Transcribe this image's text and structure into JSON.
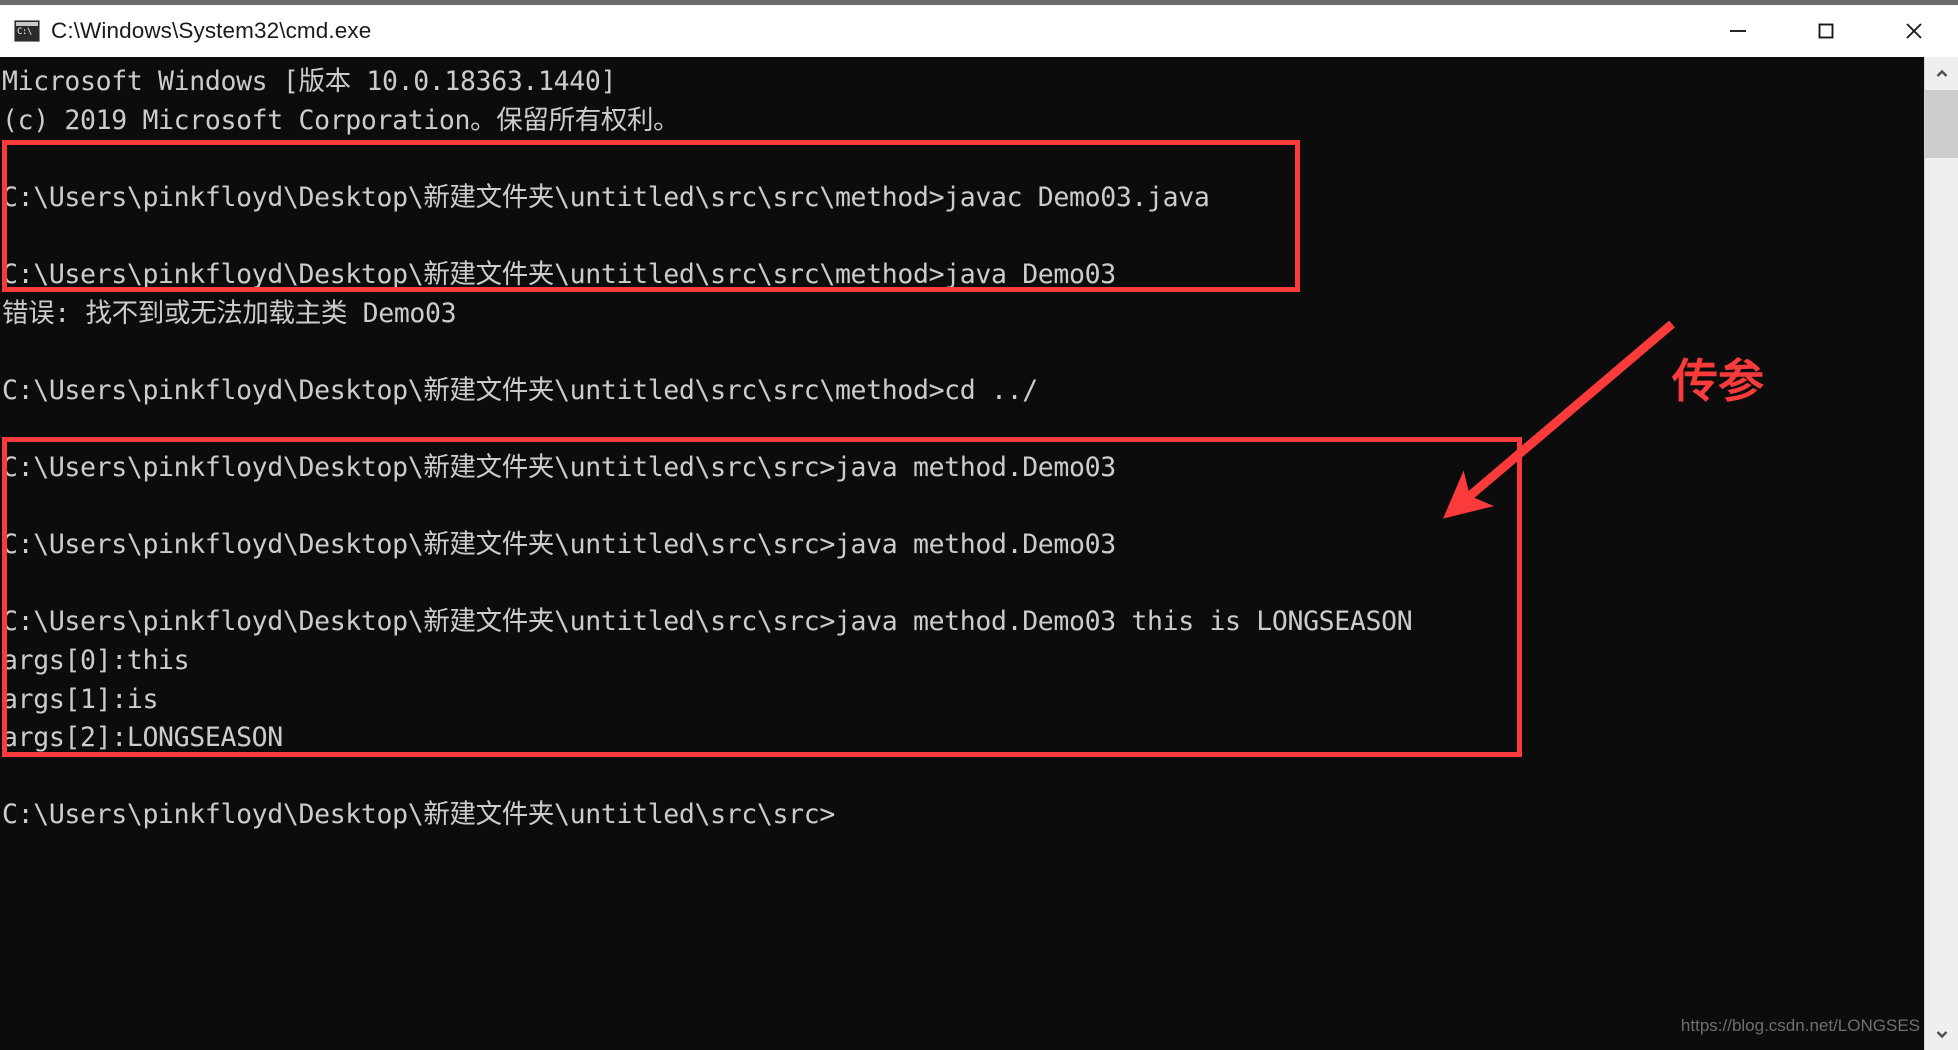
{
  "window": {
    "title": "C:\\Windows\\System32\\cmd.exe",
    "icon_label": "C:\\",
    "icon_name": "cmd-icon",
    "controls": {
      "minimize_label": "Minimize",
      "maximize_label": "Maximize",
      "close_label": "Close"
    }
  },
  "console": {
    "background_color": "#0c0c0c",
    "foreground_color": "#cccccc",
    "lines": [
      "Microsoft Windows [版本 10.0.18363.1440]",
      "(c) 2019 Microsoft Corporation。保留所有权利。",
      "",
      "C:\\Users\\pinkfloyd\\Desktop\\新建文件夹\\untitled\\src\\src\\method>javac Demo03.java",
      "",
      "C:\\Users\\pinkfloyd\\Desktop\\新建文件夹\\untitled\\src\\src\\method>java Demo03",
      "错误: 找不到或无法加载主类 Demo03",
      "",
      "C:\\Users\\pinkfloyd\\Desktop\\新建文件夹\\untitled\\src\\src\\method>cd ../",
      "",
      "C:\\Users\\pinkfloyd\\Desktop\\新建文件夹\\untitled\\src\\src>java method.Demo03",
      "",
      "C:\\Users\\pinkfloyd\\Desktop\\新建文件夹\\untitled\\src\\src>java method.Demo03",
      "",
      "C:\\Users\\pinkfloyd\\Desktop\\新建文件夹\\untitled\\src\\src>java method.Demo03 this is LONGSEASON",
      "args[0]:this",
      "args[1]:is",
      "args[2]:LONGSEASON",
      "",
      "C:\\Users\\pinkfloyd\\Desktop\\新建文件夹\\untitled\\src\\src>"
    ]
  },
  "annotations": {
    "color": "#fb3b3b",
    "label": "传参",
    "arrow_name": "red-arrow",
    "box_1_name": "highlight-box-error",
    "box_2_name": "highlight-box-args"
  },
  "watermark": {
    "text": "https://blog.csdn.net/LONGSES"
  },
  "scrollbar": {
    "up_label": "Scroll up",
    "down_label": "Scroll down",
    "thumb_label": "Scroll thumb"
  }
}
